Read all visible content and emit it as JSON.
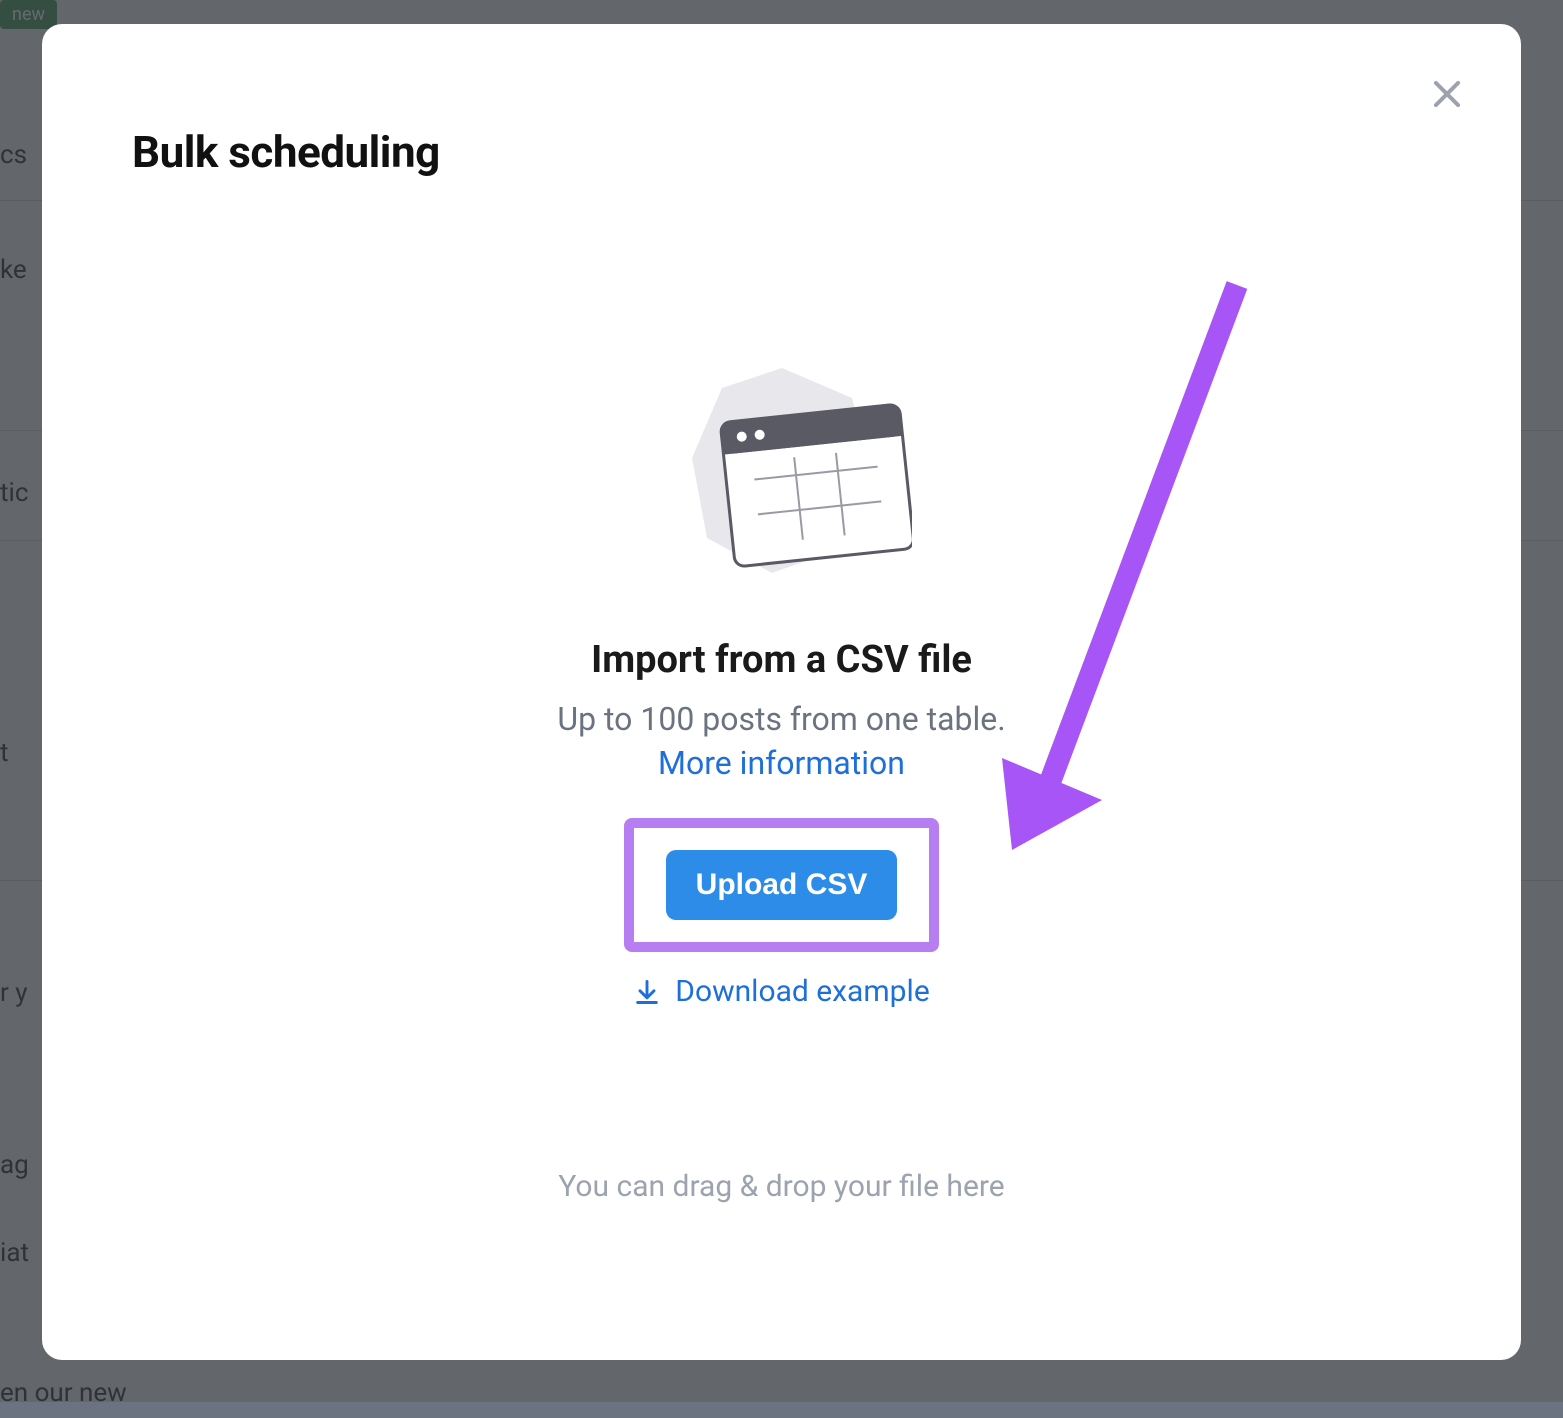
{
  "background": {
    "badge": "new",
    "items": [
      "cs",
      "ke",
      "tic",
      "t",
      "r y",
      "ag",
      "iat",
      "en our new"
    ]
  },
  "modal": {
    "title": "Bulk scheduling",
    "import_heading": "Import from a CSV file",
    "import_subtext": "Up to 100 posts from one table.",
    "more_info_label": "More information",
    "upload_button_label": "Upload CSV",
    "download_example_label": "Download example",
    "drag_drop_text": "You can drag & drop your file here"
  },
  "annotation": {
    "highlight_color": "#b67ef0",
    "arrow_color": "#a855f7"
  }
}
